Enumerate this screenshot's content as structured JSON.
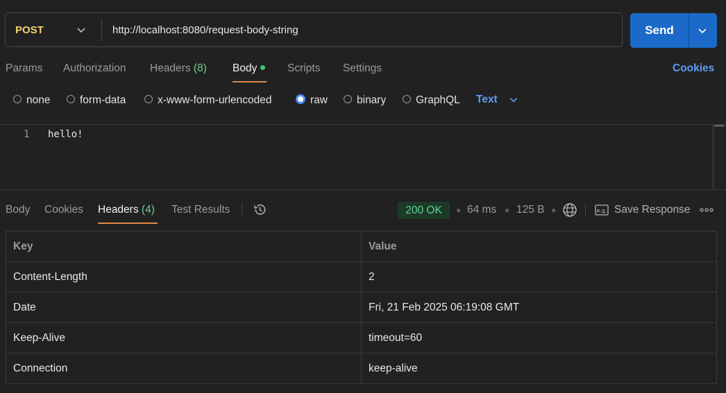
{
  "request": {
    "method": "POST",
    "url": "http://localhost:8080/request-body-string",
    "send_label": "Send"
  },
  "request_tabs": {
    "params": "Params",
    "authorization": "Authorization",
    "headers": "Headers",
    "headers_count": "(8)",
    "body": "Body",
    "scripts": "Scripts",
    "settings": "Settings",
    "cookies": "Cookies"
  },
  "body_types": {
    "none": "none",
    "form_data": "form-data",
    "urlencoded": "x-www-form-urlencoded",
    "raw": "raw",
    "binary": "binary",
    "graphql": "GraphQL",
    "selected": "raw",
    "format": "Text"
  },
  "editor": {
    "lines": [
      {
        "number": "1",
        "text": "hello!"
      }
    ]
  },
  "response_tabs": {
    "body": "Body",
    "cookies": "Cookies",
    "headers": "Headers",
    "headers_count": "(4)",
    "test_results": "Test Results"
  },
  "response_meta": {
    "status": "200 OK",
    "time": "64 ms",
    "size": "125 B",
    "save_response": "Save Response",
    "status_color": "#5fd18a"
  },
  "headers_table": {
    "columns": [
      "Key",
      "Value"
    ],
    "rows": [
      {
        "key": "Content-Length",
        "value": "2"
      },
      {
        "key": "Date",
        "value": "Fri, 21 Feb 2025 06:19:08 GMT"
      },
      {
        "key": "Keep-Alive",
        "value": "timeout=60"
      },
      {
        "key": "Connection",
        "value": "keep-alive"
      }
    ]
  },
  "colors": {
    "accent_blue": "#1b6ac9",
    "method_yellow": "#f5d36b",
    "tab_underline": "#e08a47"
  }
}
